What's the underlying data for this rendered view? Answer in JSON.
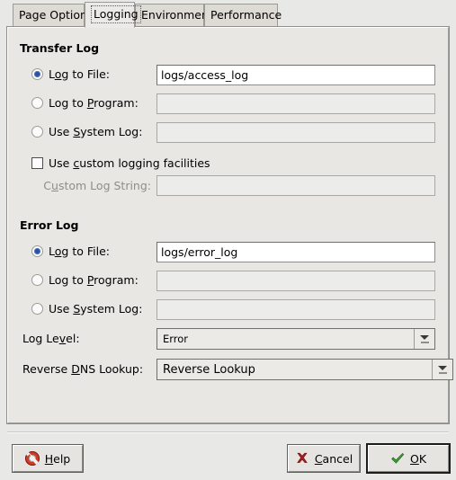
{
  "window": {
    "background_color": "#e8e8e6"
  },
  "tabs": [
    {
      "label": "Page Options",
      "active": false
    },
    {
      "label": "Logging",
      "active": true
    },
    {
      "label": "Environment",
      "active": false
    },
    {
      "label": "Performance",
      "active": false
    }
  ],
  "transfer_log": {
    "title": "Transfer Log",
    "options": [
      {
        "label_pre": "L",
        "label_mnemonic": "o",
        "label_post": "g to File:",
        "selected": true,
        "value": "logs/access_log",
        "enabled": true
      },
      {
        "label_pre": "Log to ",
        "label_mnemonic": "P",
        "label_post": "rogram:",
        "selected": false,
        "value": "",
        "enabled": false
      },
      {
        "label_pre": "Use ",
        "label_mnemonic": "S",
        "label_post": "ystem Log:",
        "selected": false,
        "value": "",
        "enabled": false
      }
    ],
    "custom_checkbox": {
      "label_pre": "Use ",
      "label_mnemonic": "c",
      "label_post": "ustom logging facilities",
      "checked": false
    },
    "custom_log_string": {
      "label_pre": "C",
      "label_mnemonic": "u",
      "label_post": "stom Log String:",
      "value": "",
      "enabled": false
    }
  },
  "error_log": {
    "title": "Error Log",
    "options": [
      {
        "label_pre": "L",
        "label_mnemonic": "o",
        "label_post": "g to File:",
        "selected": true,
        "value": "logs/error_log",
        "enabled": true
      },
      {
        "label_pre": "Log to ",
        "label_mnemonic": "P",
        "label_post": "rogram:",
        "selected": false,
        "value": "",
        "enabled": false
      },
      {
        "label_pre": "Use ",
        "label_mnemonic": "S",
        "label_post": "ystem Log:",
        "selected": false,
        "value": "",
        "enabled": false
      }
    ]
  },
  "selects": {
    "log_level": {
      "label_pre": "Log Le",
      "label_mnemonic": "v",
      "label_post": "el:",
      "value": "Error"
    },
    "reverse_dns": {
      "label_pre": "Reverse ",
      "label_mnemonic": "D",
      "label_post": "NS Lookup:",
      "value": "Reverse Lookup"
    }
  },
  "buttons": {
    "help": {
      "label_pre": "",
      "label_mnemonic": "H",
      "label_post": "elp",
      "icon": "lifebuoy-icon"
    },
    "cancel": {
      "label_pre": "",
      "label_mnemonic": "C",
      "label_post": "ancel",
      "icon": "red-x-icon"
    },
    "ok": {
      "label_pre": "",
      "label_mnemonic": "O",
      "label_post": "K",
      "icon": "green-check-icon",
      "default": true
    }
  },
  "colors": {
    "panel_bg": "#e8e7e4",
    "radio_dot": "#2c4f9e",
    "cancel_icon": "#a81f1f",
    "ok_icon": "#3f9c35",
    "help_icon": "#d03a24"
  }
}
